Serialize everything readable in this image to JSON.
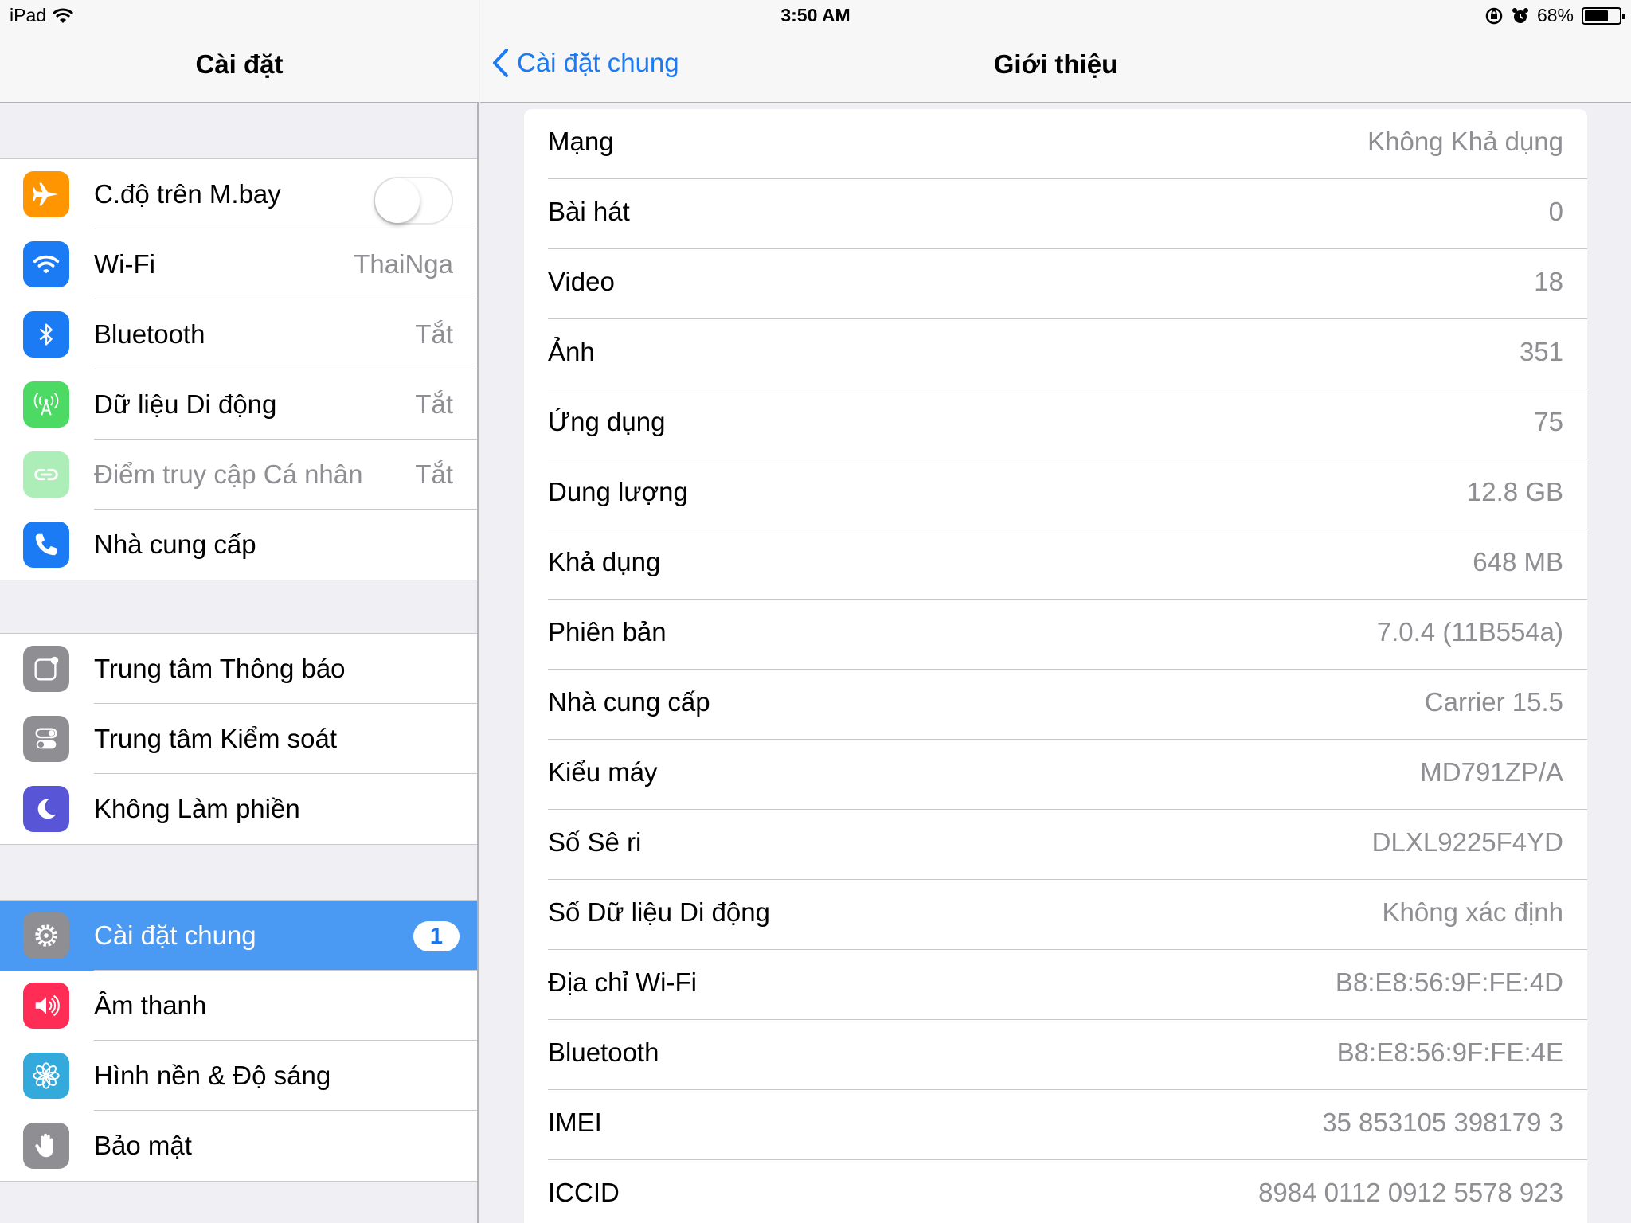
{
  "status_bar": {
    "device": "iPad",
    "time": "3:50 AM",
    "battery": "68%",
    "battery_level": 0.68
  },
  "left_panel": {
    "title": "Cài đặt",
    "group1": [
      {
        "label": "C.độ trên M.bay",
        "value": "",
        "icon": "airplane-icon",
        "color": "#ff9500",
        "toggle": "off"
      },
      {
        "label": "Wi-Fi",
        "value": "ThaiNga",
        "icon": "wifi-icon",
        "color": "#1a7bf5"
      },
      {
        "label": "Bluetooth",
        "value": "Tắt",
        "icon": "bluetooth-icon",
        "color": "#1a7bf5"
      },
      {
        "label": "Dữ liệu Di động",
        "value": "Tắt",
        "icon": "cellular-icon",
        "color": "#4cd964"
      },
      {
        "label": "Điểm truy cập Cá nhân",
        "value": "Tắt",
        "icon": "hotspot-icon",
        "color": "#4cd964"
      },
      {
        "label": "Nhà cung cấp",
        "value": "",
        "icon": "phone-icon",
        "color": "#1a7bf5"
      }
    ],
    "group2": [
      {
        "label": "Trung tâm Thông báo",
        "icon": "notifications-icon",
        "color": "#8e8e93"
      },
      {
        "label": "Trung tâm Kiểm soát",
        "icon": "control-center-icon",
        "color": "#8e8e93"
      },
      {
        "label": "Không Làm phiền",
        "icon": "moon-icon",
        "color": "#5856d6"
      }
    ],
    "group3": [
      {
        "label": "Cài đặt chung",
        "icon": "gear-icon",
        "color": "#8e8e93",
        "badge": "1",
        "selected": true
      },
      {
        "label": "Âm thanh",
        "icon": "speaker-icon",
        "color": "#ff2d55"
      },
      {
        "label": "Hình nền & Độ sáng",
        "icon": "flower-icon",
        "color": "#34aadc"
      },
      {
        "label": "Bảo mật",
        "icon": "hand-icon",
        "color": "#8e8e93"
      }
    ]
  },
  "right_panel": {
    "back_label": "Cài đặt chung",
    "title": "Giới thiệu",
    "rows": [
      {
        "label": "Mạng",
        "value": "Không Khả dụng"
      },
      {
        "label": "Bài hát",
        "value": "0"
      },
      {
        "label": "Video",
        "value": "18"
      },
      {
        "label": "Ảnh",
        "value": "351"
      },
      {
        "label": "Ứng dụng",
        "value": "75"
      },
      {
        "label": "Dung lượng",
        "value": "12.8 GB"
      },
      {
        "label": "Khả dụng",
        "value": "648 MB"
      },
      {
        "label": "Phiên bản",
        "value": "7.0.4 (11B554a)"
      },
      {
        "label": "Nhà cung cấp",
        "value": "Carrier 15.5"
      },
      {
        "label": "Kiểu máy",
        "value": "MD791ZP/A"
      },
      {
        "label": "Số Sê ri",
        "value": "DLXL9225F4YD"
      },
      {
        "label": "Số Dữ liệu Di động",
        "value": "Không xác định"
      },
      {
        "label": "Địa chỉ Wi-Fi",
        "value": "B8:E8:56:9F:FE:4D"
      },
      {
        "label": "Bluetooth",
        "value": "B8:E8:56:9F:FE:4E"
      },
      {
        "label": "IMEI",
        "value": "35 853105 398179 3"
      },
      {
        "label": "ICCID",
        "value": "8984 0112 0912 5578 923"
      }
    ]
  }
}
